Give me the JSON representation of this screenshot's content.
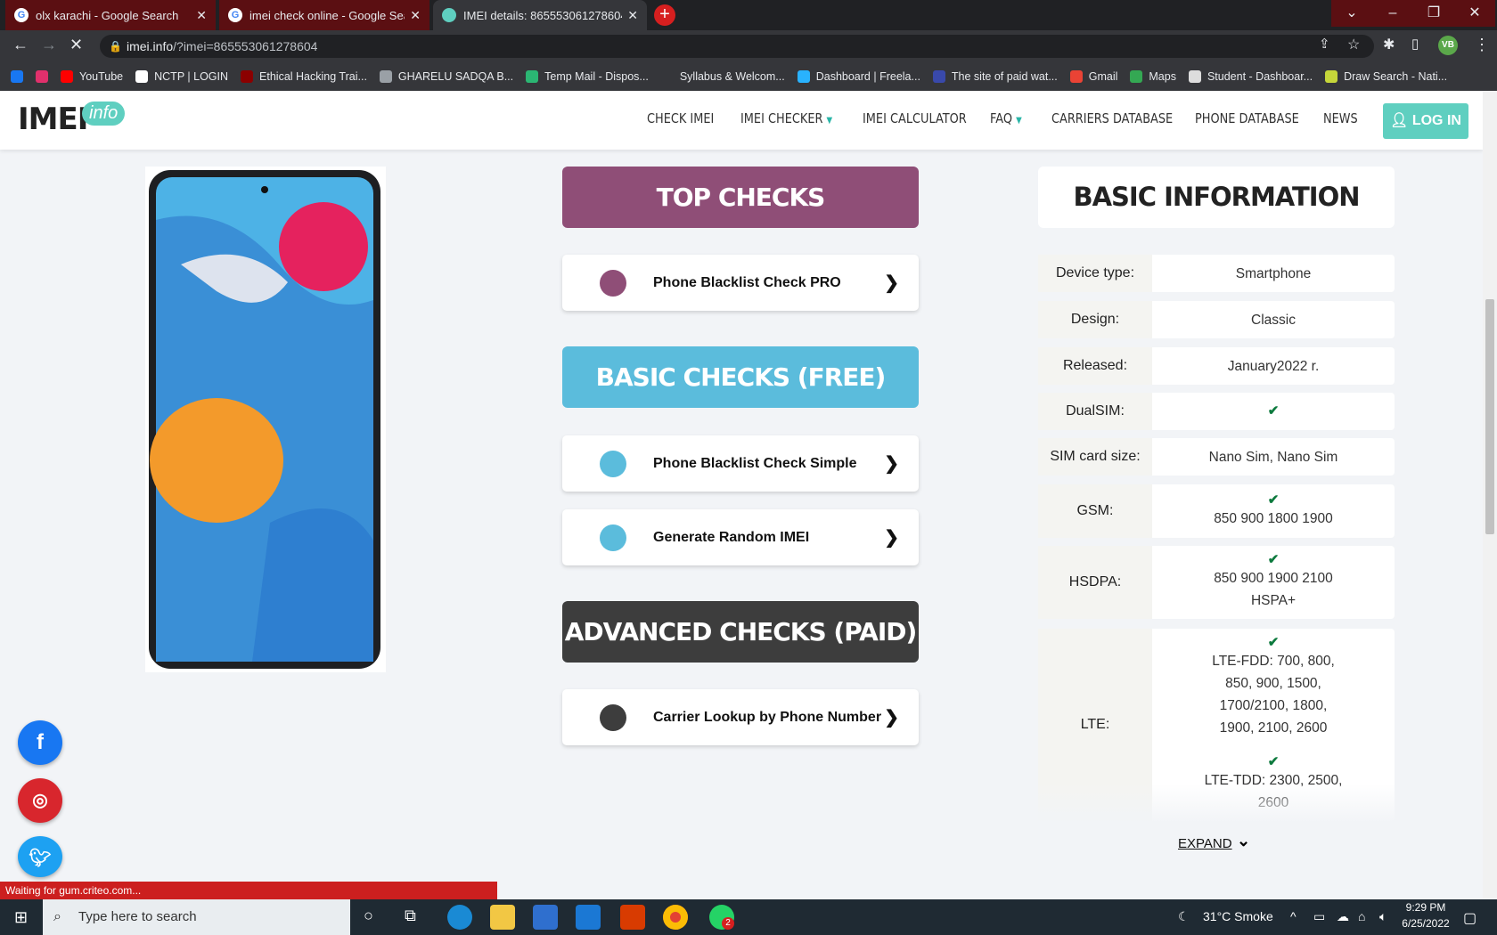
{
  "browser": {
    "tabs": [
      {
        "title": "olx karachi - Google Search",
        "favicon": "google-icon",
        "active": false
      },
      {
        "title": "imei check online - Google Searc",
        "favicon": "google-icon",
        "active": false
      },
      {
        "title": "IMEI details: 865553061278604 -",
        "favicon": "imei-info-icon",
        "active": true
      }
    ],
    "address_host": "imei.info",
    "address_path": "/?imei=865553061278604",
    "profile_initials": "VB",
    "bookmarks": [
      {
        "label": "",
        "icon": "facebook-icon",
        "color": "#1877f2"
      },
      {
        "label": "",
        "icon": "instagram-icon",
        "color": "#e1306c"
      },
      {
        "label": "YouTube",
        "icon": "youtube-icon",
        "color": "#ff0000"
      },
      {
        "label": "NCTP | LOGIN",
        "icon": "nctp-icon",
        "color": "#ffffff"
      },
      {
        "label": "Ethical Hacking Trai...",
        "icon": "hacking-icon",
        "color": "#8b0000"
      },
      {
        "label": "GHARELU SADQA B...",
        "icon": "globe-icon",
        "color": "#9aa0a6"
      },
      {
        "label": "Temp Mail - Dispos...",
        "icon": "tempmail-icon",
        "color": "#2bb673"
      },
      {
        "label": "Syllabus & Welcom...",
        "icon": "x-icon",
        "color": "#35363a"
      },
      {
        "label": "Dashboard | Freela...",
        "icon": "freelancer-icon",
        "color": "#29b2fe"
      },
      {
        "label": "The site of paid wat...",
        "icon": "mi-icon",
        "color": "#3949ab"
      },
      {
        "label": "Gmail",
        "icon": "gmail-icon",
        "color": "#ea4335"
      },
      {
        "label": "Maps",
        "icon": "maps-icon",
        "color": "#34a853"
      },
      {
        "label": "Student - Dashboar...",
        "icon": "student-icon",
        "color": "#dddddd"
      },
      {
        "label": "Draw Search - Nati...",
        "icon": "draw-icon",
        "color": "#c6d63a"
      }
    ],
    "status_text": "Waiting for gum.criteo.com..."
  },
  "site": {
    "logo_text": "IMEI",
    "logo_badge": "info",
    "nav": [
      "CHECK IMEI",
      "IMEI CHECKER",
      "IMEI CALCULATOR",
      "FAQ",
      "CARRIERS DATABASE",
      "PHONE DATABASE",
      "NEWS"
    ],
    "login_label": "LOG IN"
  },
  "checks": {
    "top_title": "TOP CHECKS",
    "top_color": "#8f4e77",
    "top_item": "Phone Blacklist Check PRO",
    "basic_title": "BASIC CHECKS (FREE)",
    "basic_color": "#5bbcdc",
    "basic_items": [
      "Phone Blacklist Check Simple",
      "Generate Random IMEI"
    ],
    "advanced_title": "ADVANCED CHECKS (PAID)",
    "advanced_color": "#3d3d3d",
    "advanced_item": "Carrier Lookup by Phone Number"
  },
  "basic_info": {
    "title": "BASIC INFORMATION",
    "device_type_label": "Device type:",
    "device_type": "Smartphone",
    "design_label": "Design:",
    "design": "Classic",
    "released_label": "Released:",
    "released": "January2022 r.",
    "dualsim_label": "DualSIM:",
    "sim_size_label": "SIM card size:",
    "sim_size": "Nano Sim, Nano Sim",
    "gsm_label": "GSM:",
    "gsm": "850 900 1800 1900",
    "hsdpa_label": "HSDPA:",
    "hsdpa": "850 900 1900 2100",
    "hsdpa_extra": "HSPA+",
    "lte_label": "LTE:",
    "lte_fdd_1": "LTE-FDD: 700, 800,",
    "lte_fdd_2": "850, 900, 1500,",
    "lte_fdd_3": "1700/2100, 1800,",
    "lte_fdd_4": "1900, 2100, 2600",
    "lte_tdd_1": "LTE-TDD: 2300, 2500,",
    "lte_tdd_2": "2600",
    "expand_label": "EXPAND"
  },
  "taskbar": {
    "search_placeholder": "Type here to search",
    "weather": "31°C  Smoke",
    "time": "9:29 PM",
    "date": "6/25/2022",
    "whatsapp_badge": "2"
  }
}
